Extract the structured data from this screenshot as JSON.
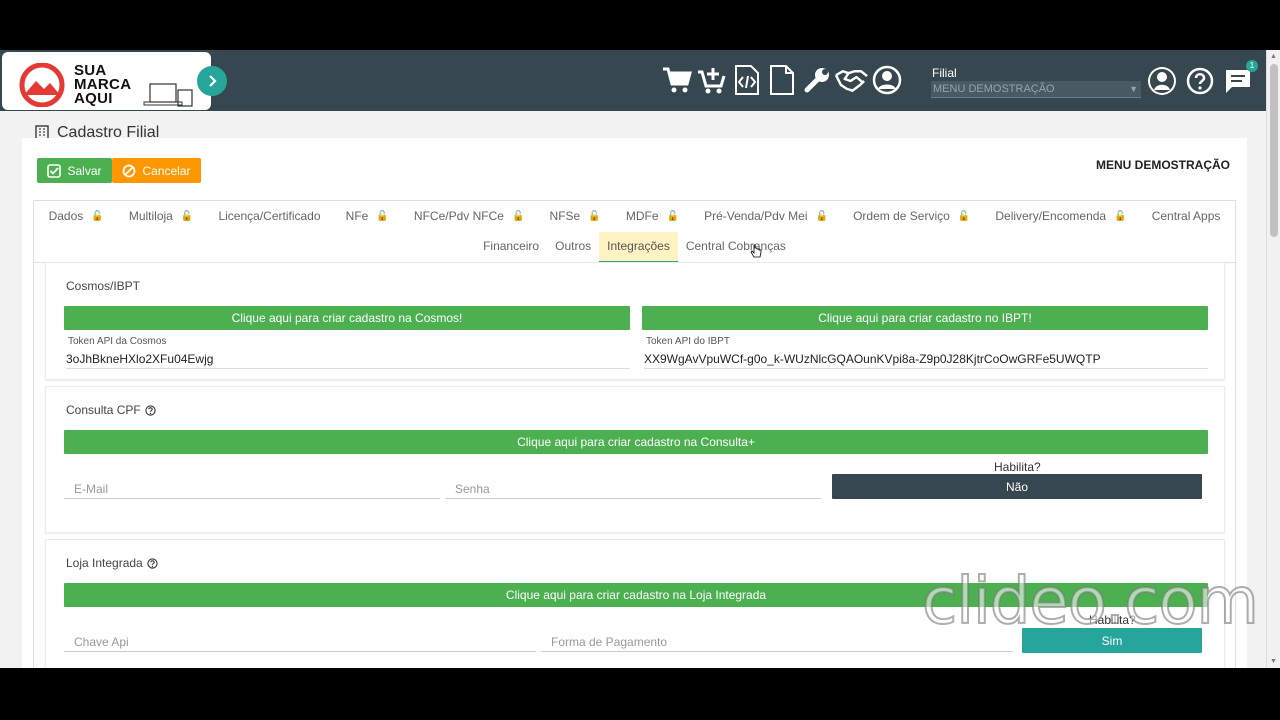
{
  "brand": {
    "line1": "SUA",
    "line2": "MARCA",
    "line3": "AQUI",
    "color": "#e53935"
  },
  "header": {
    "filial_label": "Filial",
    "filial_select_value": "MENU DEMOSTRAÇÃO",
    "notification_count": "1",
    "icons": [
      "cart-icon",
      "cart-add-icon",
      "code-file-icon",
      "document-icon",
      "wrench-icon",
      "handshake-icon",
      "user-circle-icon"
    ],
    "right_icons": [
      "user-account-icon",
      "help-icon",
      "chat-icon"
    ]
  },
  "page": {
    "title": "Cadastro Filial",
    "save_label": "Salvar",
    "cancel_label": "Cancelar",
    "company_name": "MENU DEMOSTRAÇÃO"
  },
  "tabs_row1": [
    {
      "label": "Dados",
      "locked": true
    },
    {
      "label": "Multiloja",
      "locked": true
    },
    {
      "label": "Licença/Certificado",
      "locked": false
    },
    {
      "label": "NFe",
      "locked": true
    },
    {
      "label": "NFCe/Pdv NFCe",
      "locked": true
    },
    {
      "label": "NFSe",
      "locked": true
    },
    {
      "label": "MDFe",
      "locked": true
    },
    {
      "label": "Pré-Venda/Pdv Mei",
      "locked": true
    },
    {
      "label": "Ordem de Serviço",
      "locked": true
    },
    {
      "label": "Delivery/Encomenda",
      "locked": true
    },
    {
      "label": "Central Apps",
      "locked": false
    }
  ],
  "tabs_row2": [
    {
      "label": "Financeiro",
      "active": false
    },
    {
      "label": "Outros",
      "active": false
    },
    {
      "label": "Integrações",
      "active": true
    },
    {
      "label": "Central Cobranças",
      "active": false
    }
  ],
  "cosmos": {
    "title": "Cosmos/IBPT",
    "cosmos_button": "Clique aqui para criar cadastro na Cosmos!",
    "ibpt_button": "Clique aqui para criar cadastro no IBPT!",
    "cosmos_token_label": "Token API da Cosmos",
    "cosmos_token_value": "3oJhBkneHXlo2XFu04Ewjg",
    "ibpt_token_label": "Token API do IBPT",
    "ibpt_token_value": "XX9WgAvVpuWCf-g0o_k-WUzNlcGQAOunKVpi8a-Z9p0J28KjtrCoOwGRFe5UWQTP"
  },
  "consulta_cpf": {
    "title": "Consulta CPF",
    "button": "Clique aqui para criar cadastro na Consulta+",
    "email_placeholder": "E-Mail",
    "senha_placeholder": "Senha",
    "habilita_label": "Habilita?",
    "habilita_value": "Não"
  },
  "loja_integrada": {
    "title": "Loja Integrada",
    "button": "Clique aqui para criar cadastro na Loja Integrada",
    "chave_placeholder": "Chave Api",
    "forma_placeholder": "Forma de Pagamento",
    "habilita_label": "Habilita?",
    "habilita_value": "Sim"
  },
  "watermark": "clideo.com",
  "colors": {
    "green": "#4caf50",
    "orange": "#ff9800",
    "dark": "#37474f",
    "teal": "#26a69a"
  }
}
